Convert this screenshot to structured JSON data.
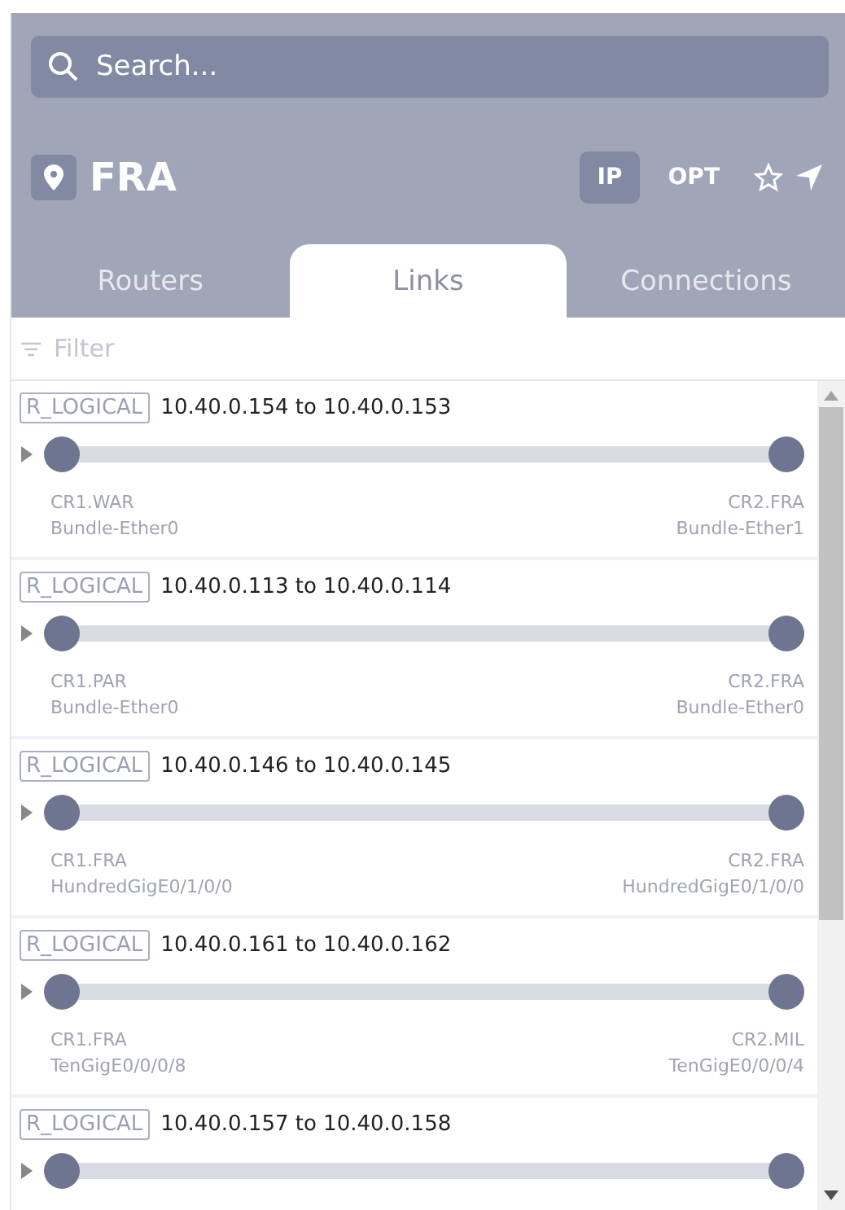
{
  "search": {
    "placeholder": "Search..."
  },
  "location": {
    "name": "FRA"
  },
  "modes": [
    {
      "label": "IP",
      "selected": true
    },
    {
      "label": "OPT",
      "selected": false
    }
  ],
  "tabs": [
    {
      "label": "Routers",
      "selected": false
    },
    {
      "label": "Links",
      "selected": true
    },
    {
      "label": "Connections",
      "selected": false
    }
  ],
  "filter": {
    "placeholder": "Filter"
  },
  "links": [
    {
      "tag": "R_LOGICAL",
      "title": "10.40.0.154 to 10.40.0.153",
      "expanded": false,
      "a": {
        "router": "CR1.WAR",
        "interface": "Bundle-Ether0"
      },
      "b": {
        "router": "CR2.FRA",
        "interface": "Bundle-Ether1"
      }
    },
    {
      "tag": "R_LOGICAL",
      "title": "10.40.0.113 to 10.40.0.114",
      "expanded": false,
      "a": {
        "router": "CR1.PAR",
        "interface": "Bundle-Ether0"
      },
      "b": {
        "router": "CR2.FRA",
        "interface": "Bundle-Ether0"
      }
    },
    {
      "tag": "R_LOGICAL",
      "title": "10.40.0.146 to 10.40.0.145",
      "expanded": false,
      "a": {
        "router": "CR1.FRA",
        "interface": "HundredGigE0/1/0/0"
      },
      "b": {
        "router": "CR2.FRA",
        "interface": "HundredGigE0/1/0/0"
      }
    },
    {
      "tag": "R_LOGICAL",
      "title": "10.40.0.161 to 10.40.0.162",
      "expanded": false,
      "a": {
        "router": "CR1.FRA",
        "interface": "TenGigE0/0/0/8"
      },
      "b": {
        "router": "CR2.MIL",
        "interface": "TenGigE0/0/0/4"
      }
    },
    {
      "tag": "R_LOGICAL",
      "title": "10.40.0.157 to 10.40.0.158",
      "expanded": false
    }
  ]
}
